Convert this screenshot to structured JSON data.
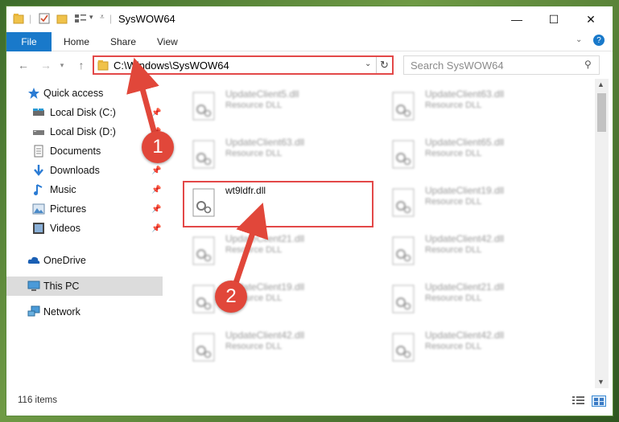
{
  "window": {
    "title": "SysWOW64",
    "controls": {
      "minimize": "—",
      "maximize": "☐",
      "close": "✕"
    }
  },
  "ribbon": {
    "tabs": [
      "File",
      "Home",
      "Share",
      "View"
    ]
  },
  "address": {
    "path": "C:\\Windows\\SysWOW64",
    "search_placeholder": "Search SysWOW64"
  },
  "sidebar": {
    "items": [
      {
        "label": "Quick access",
        "icon": "star-icon",
        "pinned": false
      },
      {
        "label": "Local Disk (C:)",
        "icon": "drive-icon",
        "pinned": true
      },
      {
        "label": "Local Disk (D:)",
        "icon": "drive-icon",
        "pinned": true
      },
      {
        "label": "Documents",
        "icon": "document-icon",
        "pinned": true
      },
      {
        "label": "Downloads",
        "icon": "download-icon",
        "pinned": true
      },
      {
        "label": "Music",
        "icon": "music-icon",
        "pinned": true
      },
      {
        "label": "Pictures",
        "icon": "pictures-icon",
        "pinned": true
      },
      {
        "label": "Videos",
        "icon": "videos-icon",
        "pinned": true
      },
      {
        "label": "OneDrive",
        "icon": "cloud-icon",
        "pinned": false
      },
      {
        "label": "This PC",
        "icon": "computer-icon",
        "pinned": false,
        "selected": true
      },
      {
        "label": "Network",
        "icon": "network-icon",
        "pinned": false
      }
    ]
  },
  "files": [
    {
      "name": "UpdateClient5.dll",
      "type": "Resource DLL",
      "blurred": true
    },
    {
      "name": "UpdateClient63.dll",
      "type": "Resource DLL",
      "blurred": true
    },
    {
      "name": "UpdateClient63.dll",
      "type": "Resource DLL",
      "blurred": true
    },
    {
      "name": "UpdateClient65.dll",
      "type": "Resource DLL",
      "blurred": true
    },
    {
      "name": "wt9ldfr.dll",
      "type": "",
      "blurred": false,
      "highlighted": true
    },
    {
      "name": "UpdateClient19.dll",
      "type": "Resource DLL",
      "blurred": true
    },
    {
      "name": "UpdateClient21.dll",
      "type": "Resource DLL",
      "blurred": true
    },
    {
      "name": "UpdateClient42.dll",
      "type": "Resource DLL",
      "blurred": true
    },
    {
      "name": "UpdateClient19.dll",
      "type": "Resource DLL",
      "blurred": true
    },
    {
      "name": "UpdateClient21.dll",
      "type": "Resource DLL",
      "blurred": true
    },
    {
      "name": "UpdateClient42.dll",
      "type": "Resource DLL",
      "blurred": true
    },
    {
      "name": "UpdateClient42.dll",
      "type": "Resource DLL",
      "blurred": true
    }
  ],
  "status": {
    "item_count": "116 items"
  },
  "annotations": {
    "step1": "1",
    "step2": "2",
    "color": "#e34848"
  },
  "colors": {
    "accent": "#1979ca",
    "highlight": "#e34848"
  }
}
